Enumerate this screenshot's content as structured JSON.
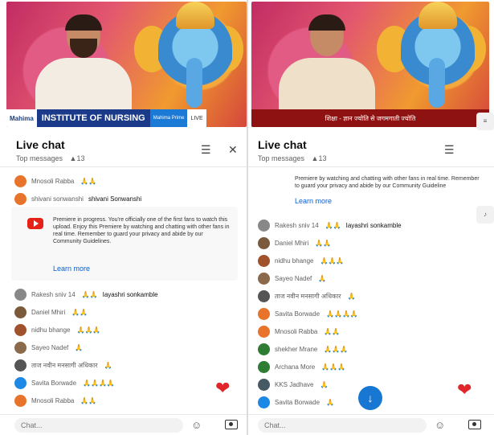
{
  "left": {
    "video": {
      "banner_left": "Mahima",
      "banner_main": "INSTITUTE OF NURSING",
      "banner_tag": "Mahima Prime",
      "banner_white": "LIVE"
    },
    "chat": {
      "title": "Live chat",
      "mode": "Top messages",
      "viewers": "▲13",
      "messages_top": [
        {
          "author": "Mnosoli Rabba",
          "text": "",
          "emoji": "🙏🙏",
          "color": "#e8732a"
        },
        {
          "author": "shivani sonwanshi",
          "text": "shivani Sonwanshi",
          "emoji": "",
          "color": "#e8732a"
        }
      ],
      "notice": {
        "text": "Premiere in progress. You're officially one of the first fans to watch this upload. Enjoy this Premiere by watching and chatting with other fans in real time. Remember to guard your privacy and abide by our Community Guidelines.",
        "link": "Learn more"
      },
      "messages": [
        {
          "author": "Rakesh sniv 14",
          "text": "Iayashri sonkamble",
          "emoji": "🙏🙏",
          "color": "#888888"
        },
        {
          "author": "Daniel Mhiri",
          "text": "",
          "emoji": "🙏🙏",
          "color": "#7a5a3a"
        },
        {
          "author": "nidhu bhange",
          "text": "",
          "emoji": "🙏🙏🙏",
          "color": "#a0522d"
        },
        {
          "author": "Sayeo Nadef",
          "text": "",
          "emoji": "🙏",
          "color": "#8a6a4a"
        },
        {
          "author": "ताज नवीन मनसागी अधिकार",
          "text": "",
          "emoji": "🙏",
          "color": "#555555"
        },
        {
          "author": "Savita Borwade",
          "text": "",
          "emoji": "🙏🙏🙏🙏",
          "color": "#1e88e5"
        },
        {
          "author": "Mnosoli Rabba",
          "text": "",
          "emoji": "🙏🙏",
          "color": "#e8732a"
        }
      ],
      "input_placeholder": "Chat..."
    }
  },
  "right": {
    "video": {
      "banner_red": "शिक्षा - ज्ञान ज्योति से जगमगाती ज्योति"
    },
    "chat": {
      "title": "Live chat",
      "mode": "Top messages",
      "viewers": "▲13",
      "notice": {
        "text": "Premiere by watching and chatting with other fans in real time. Remember to guard your privacy and abide by our Community Guideline",
        "link": "Learn more"
      },
      "messages": [
        {
          "author": "Rakesh sniv 14",
          "text": "Iayashri sonkamble",
          "emoji": "🙏🙏",
          "color": "#888888"
        },
        {
          "author": "Daniel Mhiri",
          "text": "",
          "emoji": "🙏🙏",
          "color": "#7a5a3a"
        },
        {
          "author": "nidhu bhange",
          "text": "",
          "emoji": "🙏🙏🙏",
          "color": "#a0522d"
        },
        {
          "author": "Sayeo Nadef",
          "text": "",
          "emoji": "🙏",
          "color": "#8a6a4a"
        },
        {
          "author": "ताज नवीन मनसागी अधिकार",
          "text": "",
          "emoji": "🙏",
          "color": "#555555"
        },
        {
          "author": "Savita Borwade",
          "text": "",
          "emoji": "🙏🙏🙏🙏",
          "color": "#e8732a"
        },
        {
          "author": "Mnosoli Rabba",
          "text": "",
          "emoji": "🙏🙏",
          "color": "#e8732a"
        },
        {
          "author": "shekher Mrane",
          "text": "",
          "emoji": "🙏🙏🙏",
          "color": "#2e7d32"
        },
        {
          "author": "Archana More",
          "text": "",
          "emoji": "🙏🙏🙏",
          "color": "#2e7d32"
        },
        {
          "author": "KKS Jadhave",
          "text": "",
          "emoji": "🙏",
          "color": "#455a64"
        },
        {
          "author": "Savita Borwade",
          "text": "",
          "emoji": "🙏",
          "color": "#1e88e5"
        }
      ],
      "input_placeholder": "Chat..."
    }
  },
  "icons": {
    "menu": "☰",
    "close": "✕",
    "heart": "❤",
    "down": "↓",
    "emoji": "☺",
    "side_handle_top": "≡",
    "side_handle_bottom": "♪"
  }
}
